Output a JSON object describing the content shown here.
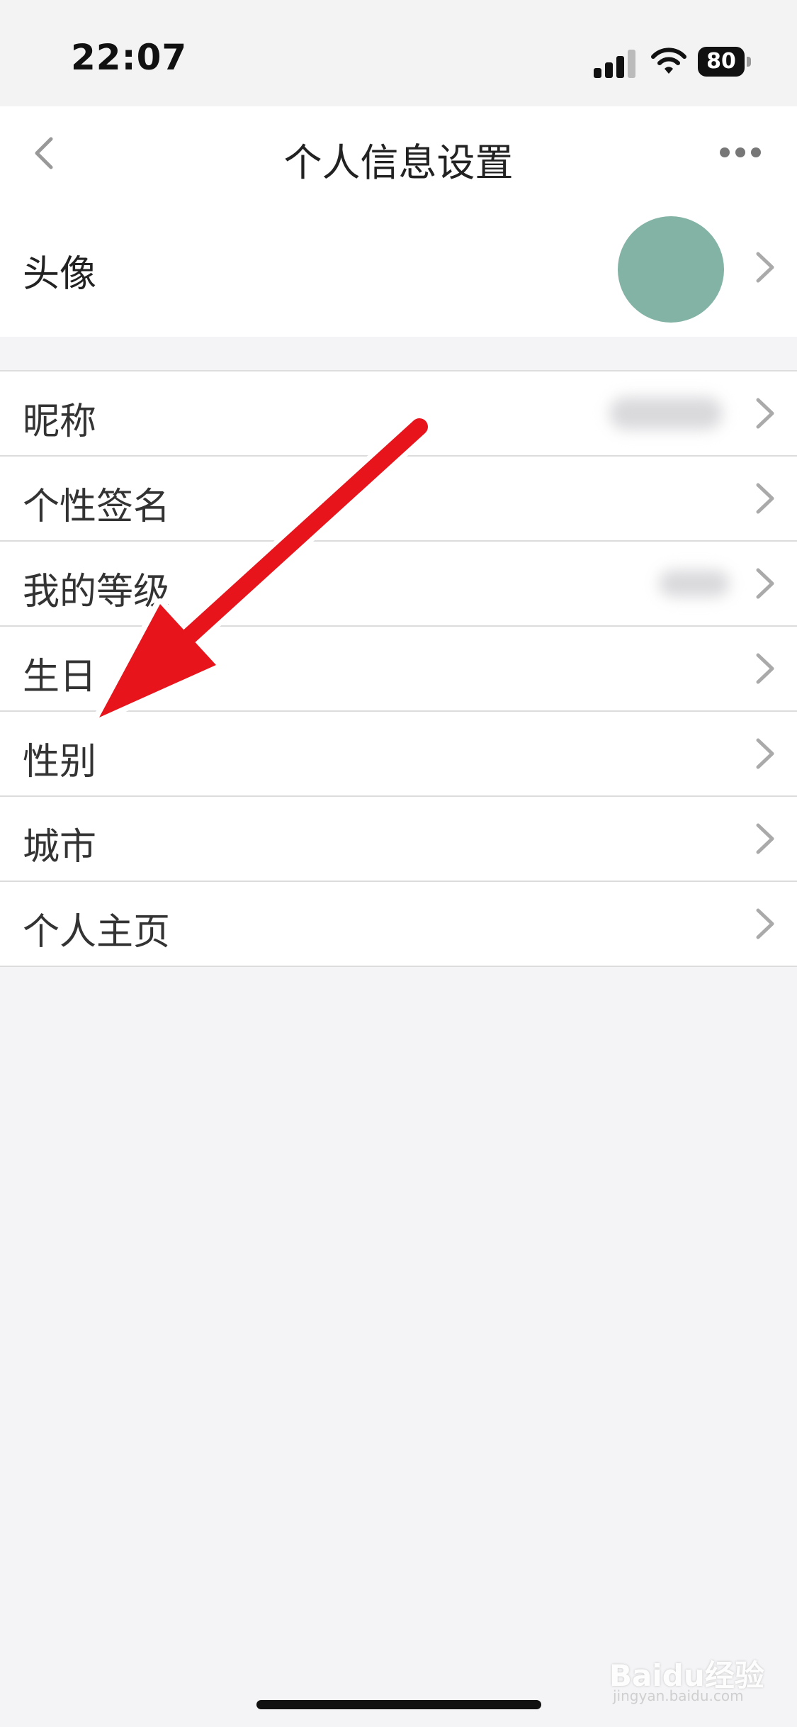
{
  "status_bar": {
    "time": "22:07",
    "battery": "80"
  },
  "nav": {
    "title": "个人信息设置"
  },
  "avatar_row": {
    "label": "头像",
    "avatar_color": "#83b3a5"
  },
  "items": [
    {
      "label": "昵称"
    },
    {
      "label": "个性签名"
    },
    {
      "label": "我的等级"
    },
    {
      "label": "生日"
    },
    {
      "label": "性别"
    },
    {
      "label": "城市"
    },
    {
      "label": "个人主页"
    }
  ],
  "annotation": {
    "color": "#e8141c"
  },
  "watermark": {
    "text": "Baidu经验",
    "sub": "jingyan.baidu.com"
  }
}
